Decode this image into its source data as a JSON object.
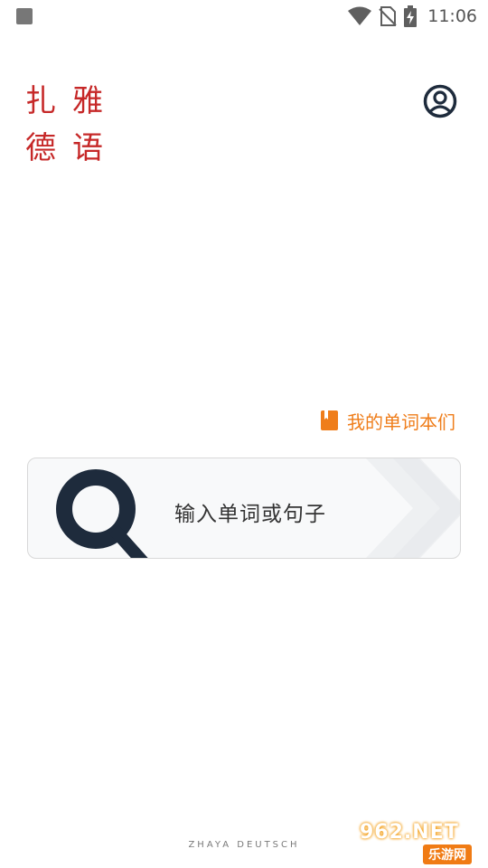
{
  "status_bar": {
    "time": "11:06",
    "icons": [
      "notification-square-icon",
      "wifi-icon",
      "no-sim-icon",
      "battery-charging-icon"
    ]
  },
  "brand": {
    "line1": "扎雅",
    "line2": "德语",
    "color": "#c62828"
  },
  "header": {
    "profile_icon": "user-circle-icon"
  },
  "notebooks_link": {
    "label": "我的单词本们",
    "icon": "book-icon",
    "color": "#ef7d1a"
  },
  "search": {
    "placeholder": "输入单词或句子",
    "icon": "magnifier-icon"
  },
  "footer": {
    "text": "ZHAYA DEUTSCH"
  },
  "watermark": {
    "top": "962.NET",
    "bottom": "乐游网"
  },
  "colors": {
    "accent_dark": "#1e2b3c",
    "accent_orange": "#ef7d1a"
  }
}
